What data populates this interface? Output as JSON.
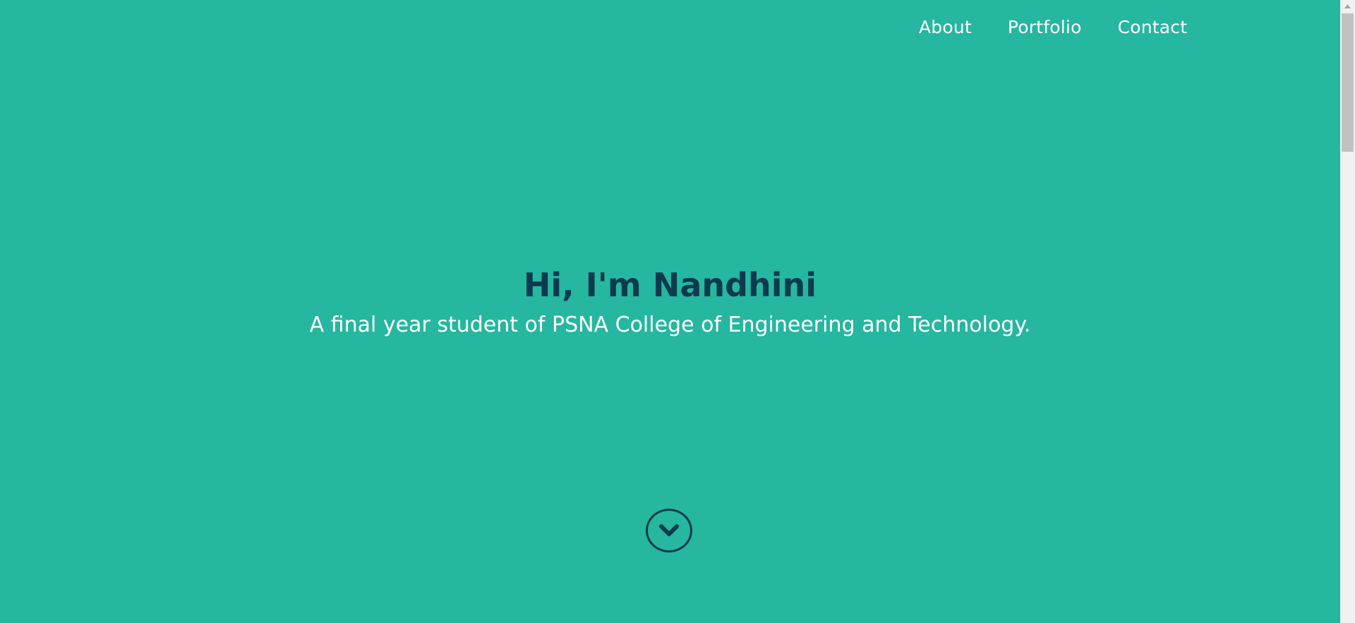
{
  "nav": {
    "items": [
      {
        "label": "About"
      },
      {
        "label": "Portfolio"
      },
      {
        "label": "Contact"
      }
    ]
  },
  "hero": {
    "heading": "Hi, I'm Nandhini",
    "subheading": "A final year student of PSNA College of Engineering and Technology.",
    "scroll_icon": "chevron-down-icon"
  },
  "colors": {
    "background": "#25b7a0",
    "heading": "#0e3a4d",
    "text": "#ffffff"
  }
}
